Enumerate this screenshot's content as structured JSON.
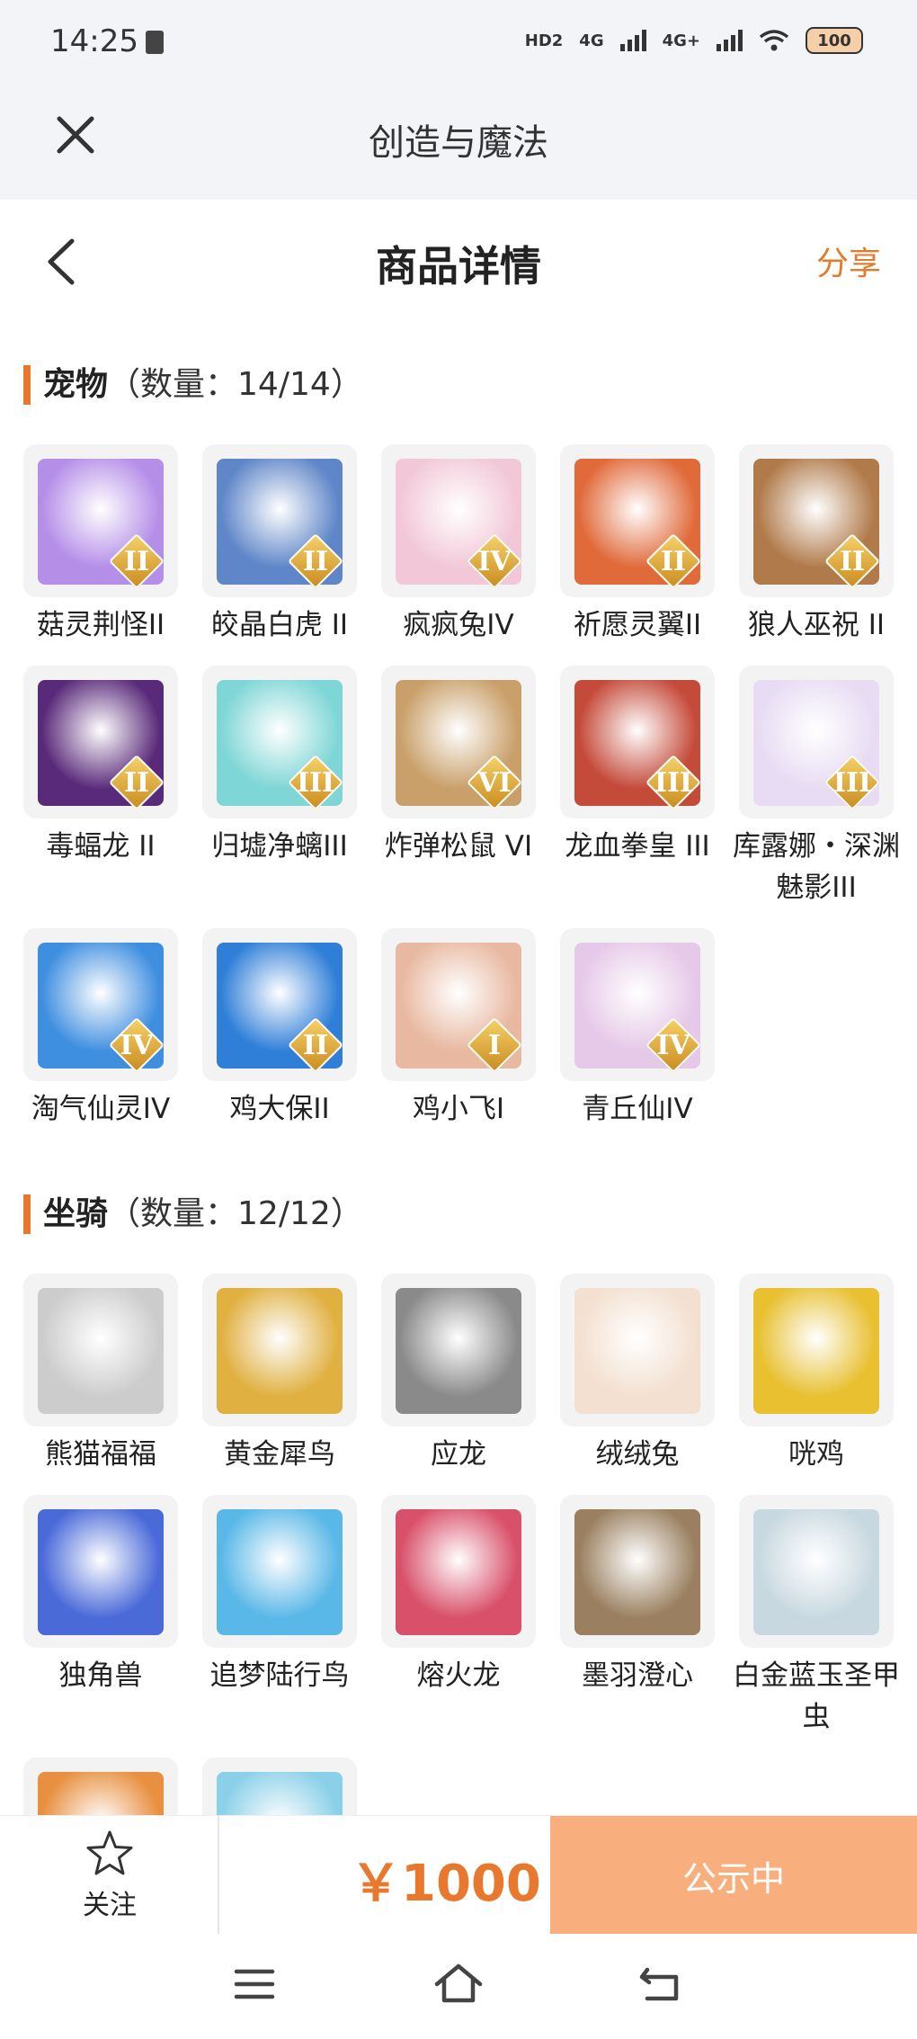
{
  "status_bar": {
    "time": "14:25",
    "hd": "HD2",
    "net1": "4G",
    "net2": "4G+",
    "battery": "100"
  },
  "app": {
    "title": "创造与魔法"
  },
  "header": {
    "title": "商品详情",
    "share": "分享"
  },
  "pets": {
    "label": "宠物",
    "count": "（数量：14/14）",
    "items": [
      {
        "name": "菇灵荆怪II",
        "rank": "II",
        "color": "#b58ee8"
      },
      {
        "name": "皎晶白虎 II",
        "rank": "II",
        "color": "#5f86c8"
      },
      {
        "name": "疯疯兔IV",
        "rank": "IV",
        "color": "#f2c8d8"
      },
      {
        "name": "祈愿灵翼II",
        "rank": "II",
        "color": "#e06a3a"
      },
      {
        "name": "狼人巫祝 II",
        "rank": "II",
        "color": "#b07a4a"
      },
      {
        "name": "毒蝠龙 II",
        "rank": "II",
        "color": "#5a2a7a"
      },
      {
        "name": "归墟净螭III",
        "rank": "III",
        "color": "#7fd6d6"
      },
      {
        "name": "炸弹松鼠 VI",
        "rank": "VI",
        "color": "#c9a06a"
      },
      {
        "name": "龙血拳皇 III",
        "rank": "III",
        "color": "#c44a3a"
      },
      {
        "name": "库露娜・深渊魅影III",
        "rank": "III",
        "color": "#e7dcf3"
      },
      {
        "name": "淘气仙灵IV",
        "rank": "IV",
        "color": "#3f8fe0"
      },
      {
        "name": "鸡大保II",
        "rank": "II",
        "color": "#2f7fd8"
      },
      {
        "name": "鸡小飞I",
        "rank": "I",
        "color": "#e8b8a0"
      },
      {
        "name": "青丘仙IV",
        "rank": "IV",
        "color": "#e6c8e8"
      }
    ]
  },
  "mounts": {
    "label": "坐骑",
    "count": "（数量：12/12）",
    "items": [
      {
        "name": "熊猫福福",
        "color": "#cccccc"
      },
      {
        "name": "黄金犀鸟",
        "color": "#e0b040"
      },
      {
        "name": "应龙",
        "color": "#8a8a8a"
      },
      {
        "name": "绒绒兔",
        "color": "#f3e0d0"
      },
      {
        "name": "咣鸡",
        "color": "#e8c030"
      },
      {
        "name": "独角兽",
        "color": "#4a6ad8"
      },
      {
        "name": "追梦陆行鸟",
        "color": "#5ab8e8"
      },
      {
        "name": "熔火龙",
        "color": "#d8506a"
      },
      {
        "name": "墨羽澄心",
        "color": "#9a8060"
      },
      {
        "name": "白金蓝玉圣甲虫",
        "color": "#c8d8e0"
      },
      {
        "name": "",
        "color": "#e89040"
      },
      {
        "name": "",
        "color": "#8ad0e8"
      }
    ]
  },
  "bottom_bar": {
    "follow": "关注",
    "price": "￥1000",
    "status": "公示中"
  }
}
